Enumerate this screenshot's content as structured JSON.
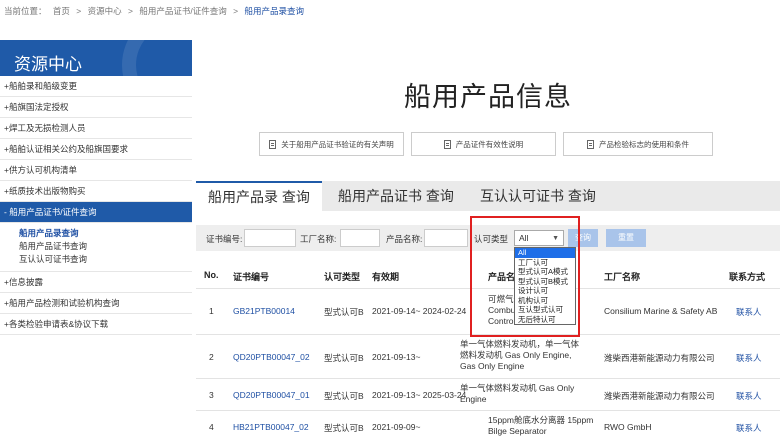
{
  "breadcrumb": {
    "prefix": "当前位置：",
    "items": [
      "首页",
      ">",
      "资源中心",
      ">",
      "船用产品证书/证件查询",
      ">"
    ],
    "current": "船用产品录查询"
  },
  "sidebar": {
    "title": "资源中心",
    "items_top": [
      "+船舶录和船级变更",
      "+船旗国法定授权",
      "+焊工及无损检测人员",
      "+船舶认证相关公约及船旗国要求",
      "+供方认可机构清单",
      "+纸质技术出版物购买"
    ],
    "active_item": "- 船用产品证书/证件查询",
    "sub_items": [
      "船用产品录查询",
      "船用产品证书查询",
      "互认认可证书查询"
    ],
    "items_bottom": [
      "+信息披露",
      "+船用产品检测和试验机构查询",
      "+各类检验申请表&协议下载"
    ]
  },
  "main": {
    "title": "船用产品信息",
    "doc_buttons": [
      "关于船用产品证书验证的有关声明",
      "产品证件有效性说明",
      "产品检验标志的使用和条件"
    ],
    "tabs": [
      "船用产品录 查询",
      "船用产品证书 查询",
      "互认认可证书 查询"
    ]
  },
  "filters": {
    "cert_no_label": "证书编号:",
    "factory_label": "工厂名称:",
    "product_label": "产品名称:",
    "approval_label": "认可类型",
    "approval_value": "All",
    "search_label": "查询",
    "reset_label": "重置",
    "options": [
      "All",
      "工厂认可",
      "型式认可A模式",
      "型式认可B模式",
      "设计认可",
      "机构认可",
      "互认型式认可",
      "无后特认可"
    ]
  },
  "table": {
    "headers": [
      "No.",
      "证书编号",
      "认可类型",
      "有效期",
      "产品名称",
      "工厂名称",
      "联系方式"
    ],
    "rows": [
      {
        "no": "1",
        "cert": "GB21PTB00014",
        "type": "型式认可B",
        "validity": "2021-09-14~ 2024-02-24",
        "product": [
          "可燃气体",
          "Combus",
          "Control"
        ],
        "factory": "Consilium Marine & Safety AB",
        "contact": "联系人"
      },
      {
        "no": "2",
        "cert": "QD20PTB00047_02",
        "type": "型式认可B",
        "validity": "2021-09-13~",
        "product": [
          "单一气体燃料发动机，单一气体",
          "燃料发动机 Gas Only Engine,",
          "Gas Only Engine"
        ],
        "factory": "潍柴西港新能源动力有限公司",
        "contact": "联系人"
      },
      {
        "no": "3",
        "cert": "QD20PTB00047_01",
        "type": "型式认可B",
        "validity": "2021-09-13~ 2025-03-24",
        "product": [
          "单一气体燃料发动机 Gas Only",
          "Engine"
        ],
        "factory": "潍柴西港新能源动力有限公司",
        "contact": "联系人"
      },
      {
        "no": "4",
        "cert": "HB21PTB00047_02",
        "type": "型式认可B",
        "validity": "2021-09-09~",
        "product": [
          "15ppm舱底水分离器 15ppm",
          "Bilge Separator"
        ],
        "factory": "RWO GmbH",
        "contact": "联系人"
      }
    ]
  },
  "colors": {
    "brand": "#1f5aa8",
    "link": "#1e4fa3",
    "highlight": "#e02020",
    "selected_option": "#1e6ee8"
  }
}
